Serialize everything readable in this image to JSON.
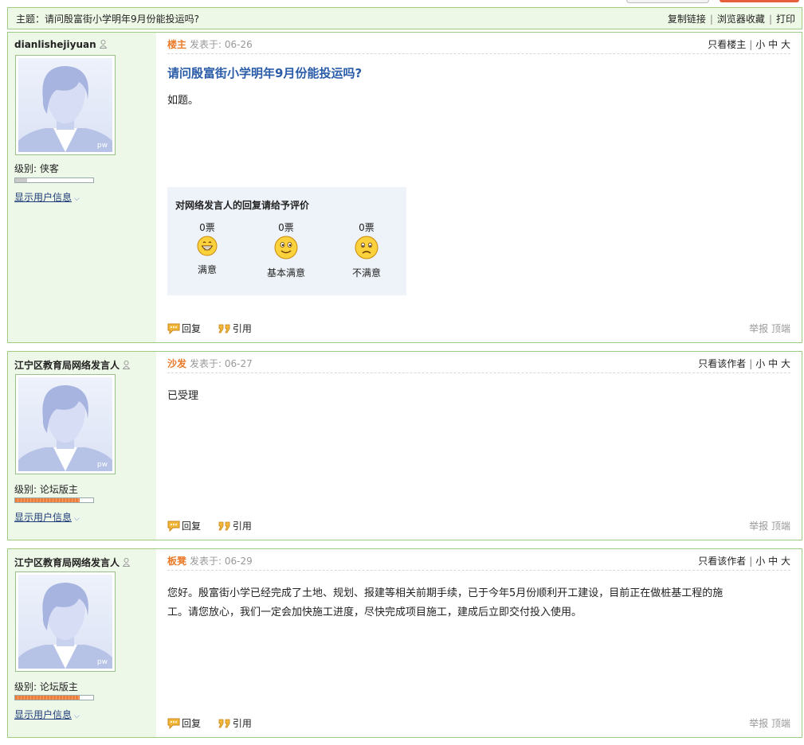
{
  "topic": {
    "label": "主题：请问殷富街小学明年9月份能投运吗?",
    "actions": [
      "复制链接",
      "浏览器收藏",
      "打印"
    ]
  },
  "posts": [
    {
      "username": "dianlishejiyuan",
      "level_label": "级别: 侠客",
      "level_progress": 0.15,
      "show_info": "显示用户信息",
      "floor": "楼主",
      "posted": "发表于: 06-26",
      "view_only": "只看楼主",
      "font_sizes": [
        "小",
        "中",
        "大"
      ],
      "title": "请问殷富街小学明年9月份能投运吗?",
      "body": "如题。",
      "reply": "回复",
      "quote": "引用",
      "report": "举报",
      "top": "顶端"
    },
    {
      "username": "江宁区教育局网络发言人",
      "level_label": "级别: 论坛版主",
      "level_progress": 0.83,
      "show_info": "显示用户信息",
      "floor": "沙发",
      "posted": "发表于: 06-27",
      "view_only": "只看该作者",
      "font_sizes": [
        "小",
        "中",
        "大"
      ],
      "body": "已受理",
      "reply": "回复",
      "quote": "引用",
      "report": "举报",
      "top": "顶端"
    },
    {
      "username": "江宁区教育局网络发言人",
      "level_label": "级别: 论坛版主",
      "level_progress": 0.83,
      "show_info": "显示用户信息",
      "floor": "板凳",
      "posted": "发表于: 06-29",
      "view_only": "只看该作者",
      "font_sizes": [
        "小",
        "中",
        "大"
      ],
      "body_lines": [
        "您好。殷富街小学已经完成了土地、规划、报建等相关前期手续，已于今年5月份顺利开工建设，目前正在做桩基工程的施",
        "工。请您放心，我们一定会加快施工进度，尽快完成项目施工，建成后立即交付投入使用。"
      ],
      "reply": "回复",
      "quote": "引用",
      "report": "举报",
      "top": "顶端"
    }
  ],
  "rating": {
    "title": "对网络发言人的回复请给予评价",
    "options": [
      {
        "votes": "0票",
        "label": "满意",
        "icon": "grinning-face-icon"
      },
      {
        "votes": "0票",
        "label": "基本满意",
        "icon": "smiling-face-icon"
      },
      {
        "votes": "0票",
        "label": "不满意",
        "icon": "frowning-face-icon"
      }
    ]
  },
  "colors": {
    "border": "#9bcd87",
    "sidebar_bg": "#eef8e8",
    "floor_label": "#ea7a28",
    "title": "#2a5ca8",
    "level_bar": "#ee7c3a"
  }
}
